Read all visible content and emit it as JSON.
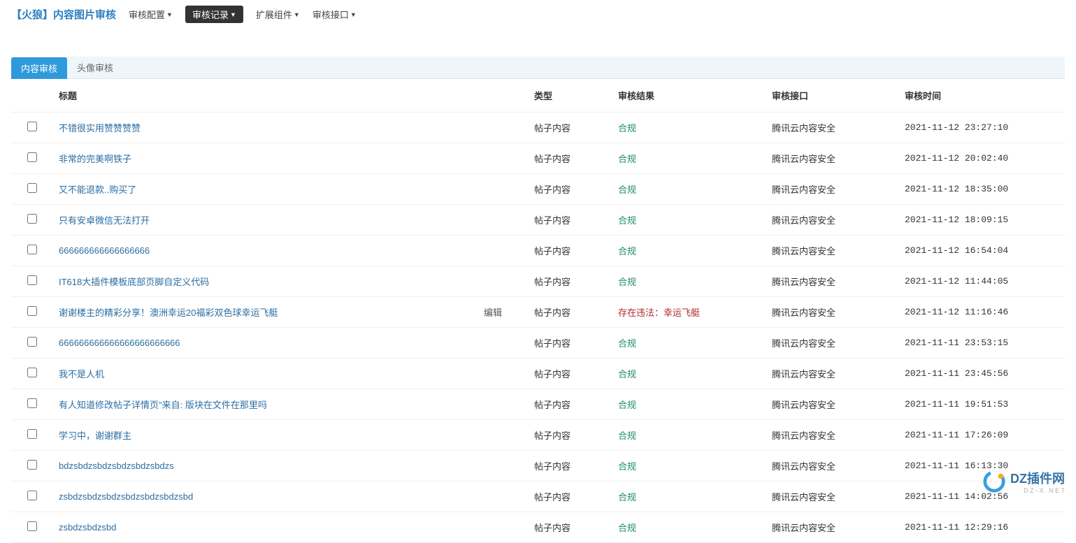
{
  "brand": "【火狼】内容图片审核",
  "nav": [
    {
      "label": "审核配置",
      "active": false
    },
    {
      "label": "审核记录",
      "active": true
    },
    {
      "label": "扩展组件",
      "active": false
    },
    {
      "label": "审核接口",
      "active": false
    }
  ],
  "tabs": [
    {
      "label": "内容审核",
      "active": true
    },
    {
      "label": "头像审核",
      "active": false
    }
  ],
  "columns": {
    "title": "标题",
    "type": "类型",
    "result": "审核结果",
    "api": "审核接口",
    "time": "审核时间"
  },
  "edit_label": "编辑",
  "result_labels": {
    "ok": "合规",
    "bad_prefix": "存在违法："
  },
  "rows": [
    {
      "title": "不错很实用赞赞赞赞",
      "type": "帖子内容",
      "result": "合规",
      "result_ok": true,
      "api": "腾讯云内容安全",
      "time": "2021-11-12 23:27:10",
      "editable": false
    },
    {
      "title": "非常的完美啊铁子",
      "type": "帖子内容",
      "result": "合规",
      "result_ok": true,
      "api": "腾讯云内容安全",
      "time": "2021-11-12 20:02:40",
      "editable": false
    },
    {
      "title": "又不能退款..购买了",
      "type": "帖子内容",
      "result": "合规",
      "result_ok": true,
      "api": "腾讯云内容安全",
      "time": "2021-11-12 18:35:00",
      "editable": false
    },
    {
      "title": "只有安卓微信无法打开",
      "type": "帖子内容",
      "result": "合规",
      "result_ok": true,
      "api": "腾讯云内容安全",
      "time": "2021-11-12 18:09:15",
      "editable": false
    },
    {
      "title": "666666666666666666",
      "type": "帖子内容",
      "result": "合规",
      "result_ok": true,
      "api": "腾讯云内容安全",
      "time": "2021-11-12 16:54:04",
      "editable": false
    },
    {
      "title": "IT618大插件模板底部页脚自定义代码",
      "type": "帖子内容",
      "result": "合规",
      "result_ok": true,
      "api": "腾讯云内容安全",
      "time": "2021-11-12 11:44:05",
      "editable": false
    },
    {
      "title": "谢谢楼主的精彩分享！澳洲幸运20福彩双色球幸运飞艇",
      "type": "帖子内容",
      "result": "存在违法：幸运飞艇",
      "result_ok": false,
      "api": "腾讯云内容安全",
      "time": "2021-11-12 11:16:46",
      "editable": true
    },
    {
      "title": "666666666666666666666666",
      "type": "帖子内容",
      "result": "合规",
      "result_ok": true,
      "api": "腾讯云内容安全",
      "time": "2021-11-11 23:53:15",
      "editable": false
    },
    {
      "title": "我不是人机",
      "type": "帖子内容",
      "result": "合规",
      "result_ok": true,
      "api": "腾讯云内容安全",
      "time": "2021-11-11 23:45:56",
      "editable": false
    },
    {
      "title": "有人知道修改帖子详情页\"来自: 版块在文件在那里吗",
      "type": "帖子内容",
      "result": "合规",
      "result_ok": true,
      "api": "腾讯云内容安全",
      "time": "2021-11-11 19:51:53",
      "editable": false
    },
    {
      "title": "学习中，谢谢群主",
      "type": "帖子内容",
      "result": "合规",
      "result_ok": true,
      "api": "腾讯云内容安全",
      "time": "2021-11-11 17:26:09",
      "editable": false
    },
    {
      "title": "bdzsbdzsbdzsbdzsbdzsbdzs",
      "type": "帖子内容",
      "result": "合规",
      "result_ok": true,
      "api": "腾讯云内容安全",
      "time": "2021-11-11 16:13:30",
      "editable": false
    },
    {
      "title": "zsbdzsbdzsbdzsbdzsbdzsbdzsbd",
      "type": "帖子内容",
      "result": "合规",
      "result_ok": true,
      "api": "腾讯云内容安全",
      "time": "2021-11-11 14:02:56",
      "editable": false
    },
    {
      "title": "zsbdzsbdzsbd",
      "type": "帖子内容",
      "result": "合规",
      "result_ok": true,
      "api": "腾讯云内容安全",
      "time": "2021-11-11 12:29:16",
      "editable": false
    }
  ],
  "watermark": {
    "text": "DZ插件网",
    "sub": "D Z - X . N E T"
  }
}
